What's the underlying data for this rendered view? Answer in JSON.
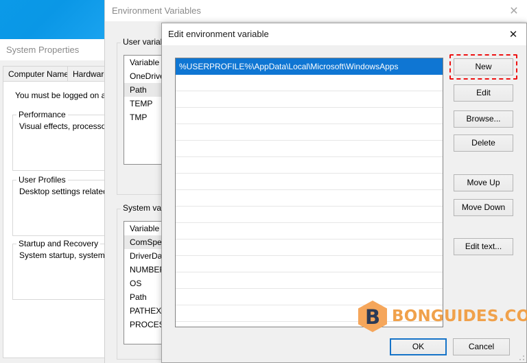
{
  "desktop": {
    "banner_color": "#0b9ae8"
  },
  "system_properties": {
    "title": "System Properties",
    "tabs": [
      {
        "label": "Computer Name"
      },
      {
        "label": "Hardware"
      }
    ],
    "note": "You must be logged on as a",
    "groups": [
      {
        "title": "Performance",
        "text": "Visual effects, processor s"
      },
      {
        "title": "User Profiles",
        "text": "Desktop settings related to"
      },
      {
        "title": "Startup and Recovery",
        "text": "System startup, system fail"
      }
    ]
  },
  "environment_variables": {
    "title": "Environment Variables",
    "close_icon": "close-icon",
    "user_variables": {
      "group_title": "User variable",
      "column_header": "Variable",
      "rows": [
        {
          "name": "OneDrive",
          "selected": false
        },
        {
          "name": "Path",
          "selected": true
        },
        {
          "name": "TEMP",
          "selected": false
        },
        {
          "name": "TMP",
          "selected": false
        }
      ]
    },
    "system_variables": {
      "group_title": "System varia",
      "column_header": "Variable",
      "rows": [
        {
          "name": "ComSpec",
          "selected": true
        },
        {
          "name": "DriverData",
          "selected": false
        },
        {
          "name": "NUMBER_",
          "selected": false
        },
        {
          "name": "OS",
          "selected": false
        },
        {
          "name": "Path",
          "selected": false
        },
        {
          "name": "PATHEXT",
          "selected": false
        },
        {
          "name": "PROCESSO",
          "selected": false
        }
      ]
    }
  },
  "edit_variable_dialog": {
    "title": "Edit environment variable",
    "close_icon": "close-icon",
    "selection_color": "#0f76d3",
    "paths": [
      {
        "value": "%USERPROFILE%\\AppData\\Local\\Microsoft\\WindowsApps",
        "selected": true
      },
      {
        "value": "",
        "selected": false
      },
      {
        "value": "",
        "selected": false
      },
      {
        "value": "",
        "selected": false
      },
      {
        "value": "",
        "selected": false
      },
      {
        "value": "",
        "selected": false
      },
      {
        "value": "",
        "selected": false
      },
      {
        "value": "",
        "selected": false
      },
      {
        "value": "",
        "selected": false
      },
      {
        "value": "",
        "selected": false
      },
      {
        "value": "",
        "selected": false
      },
      {
        "value": "",
        "selected": false
      },
      {
        "value": "",
        "selected": false
      },
      {
        "value": "",
        "selected": false
      },
      {
        "value": "",
        "selected": false
      },
      {
        "value": "",
        "selected": false
      }
    ],
    "side_buttons": {
      "new": "New",
      "edit": "Edit",
      "browse": "Browse...",
      "delete": "Delete",
      "move_up": "Move Up",
      "move_down": "Move Down",
      "edit_text": "Edit text..."
    },
    "footer_buttons": {
      "ok": "OK",
      "cancel": "Cancel"
    },
    "annotation": {
      "target": "New",
      "color": "#ee1111",
      "style": "dashed-rectangle"
    }
  },
  "watermark": {
    "text": "BONGUIDES.COM",
    "logo_letter": "B",
    "logo_bg_color": "#f5a65b",
    "logo_letter_color": "#2b3a56",
    "text_color": "#f0a14b"
  }
}
